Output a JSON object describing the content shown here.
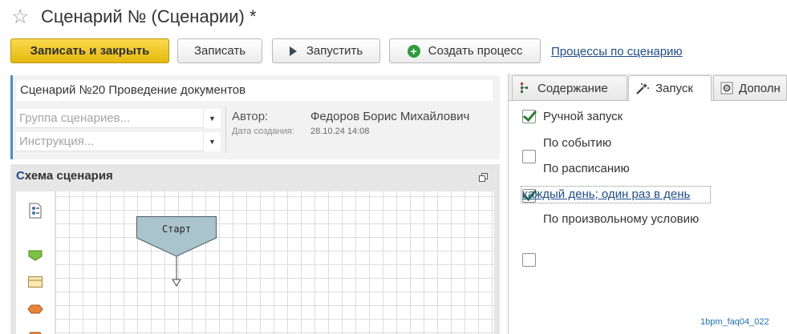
{
  "window": {
    "title": "Сценарий № (Сценарии) *"
  },
  "toolbar": {
    "save_close": "Записать и закрыть",
    "save": "Записать",
    "run": "Запустить",
    "create_process": "Создать процесс",
    "processes_link": "Процессы по сценарию"
  },
  "form": {
    "name_value": "Сценарий №20 Проведение документов",
    "group_placeholder": "Группа сценариев...",
    "instruction_placeholder": "Инструкция...",
    "author_label": "Автор:",
    "author_value": "Федоров Борис Михайлович",
    "created_label": "Дата создания:",
    "created_value": "28.10.24 14:08"
  },
  "schema": {
    "title_first": "С",
    "title_rest": "хема сценария",
    "start_node": "Старт"
  },
  "tabs": [
    {
      "label": "Содержание"
    },
    {
      "label": "Запуск"
    },
    {
      "label": "Дополн"
    }
  ],
  "launch": {
    "manual": {
      "label": "Ручной запуск",
      "checked": true
    },
    "event": {
      "label": "По событию",
      "checked": false
    },
    "schedule": {
      "label": "По расписанию",
      "checked": true
    },
    "schedule_link": "каждый день; один раз в день",
    "custom": {
      "label": "По произвольному условию",
      "checked": false
    }
  },
  "footer": {
    "code": "1bpm_faq04_022"
  },
  "colors": {
    "accent": "#e4b90e",
    "link": "#1e4d8c",
    "check": "#2a7d2e",
    "node": "#a9c4cc"
  }
}
